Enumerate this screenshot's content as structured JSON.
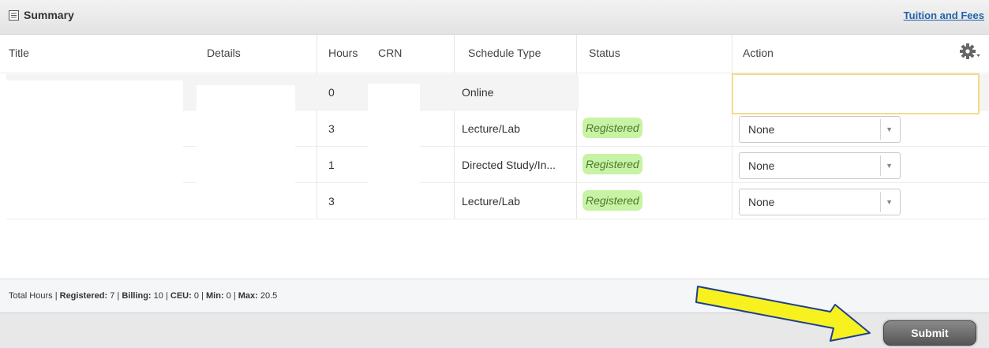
{
  "panel": {
    "title": "Summary",
    "link": "Tuition and Fees"
  },
  "columns": {
    "title": "Title",
    "details": "Details",
    "hours": "Hours",
    "crn": "CRN",
    "schedule_type": "Schedule Type",
    "status": "Status",
    "action": "Action"
  },
  "rows": [
    {
      "hours": "0",
      "schedule_type": "Online"
    },
    {
      "hours": "3",
      "schedule_type": "Lecture/Lab",
      "status": "Registered",
      "action": "None"
    },
    {
      "hours": "1",
      "schedule_type": "Directed Study/In...",
      "status": "Registered",
      "action": "None"
    },
    {
      "hours": "3",
      "schedule_type": "Lecture/Lab",
      "status": "Registered",
      "action": "None"
    }
  ],
  "totals": {
    "label": "Total Hours |",
    "registered_label": "Registered:",
    "registered": "7",
    "billing_label": "Billing:",
    "billing": "10",
    "ceu_label": "CEU:",
    "ceu": "0",
    "min_label": "Min:",
    "min": "0",
    "max_label": "Max:",
    "max": "20.5"
  },
  "submit_label": "Submit",
  "colors": {
    "badge_bg": "#c8f2a4",
    "link": "#2462a8",
    "arrow_fill": "#f7f21f",
    "arrow_stroke": "#1f3f8f"
  },
  "icons": [
    "summary-icon",
    "gear-icon",
    "chevron-down-icon",
    "arrow-annotation"
  ]
}
